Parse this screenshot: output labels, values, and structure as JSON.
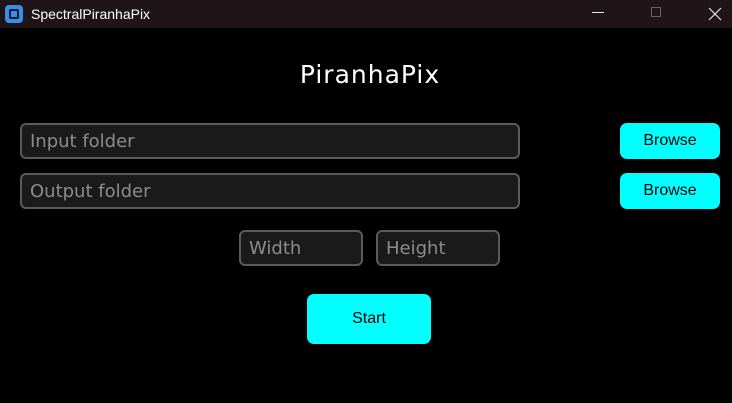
{
  "window": {
    "title": "SpectralPiranhaPix",
    "controls": [
      "minimize-icon",
      "maximize-icon",
      "close-icon"
    ]
  },
  "app": {
    "heading": "PiranhaPix"
  },
  "form": {
    "input_folder": {
      "placeholder": "Input folder",
      "value": ""
    },
    "output_folder": {
      "placeholder": "Output folder",
      "value": ""
    },
    "width": {
      "placeholder": "Width",
      "value": ""
    },
    "height": {
      "placeholder": "Height",
      "value": ""
    },
    "browse_input_label": "Browse",
    "browse_output_label": "Browse",
    "start_label": "Start"
  },
  "colors": {
    "background": "#000000",
    "titlebar": "#1f1418",
    "accent": "#00ffff",
    "field_bg": "#1a1a1a",
    "field_border": "#5a5a5a",
    "placeholder": "#8c8c8c"
  }
}
